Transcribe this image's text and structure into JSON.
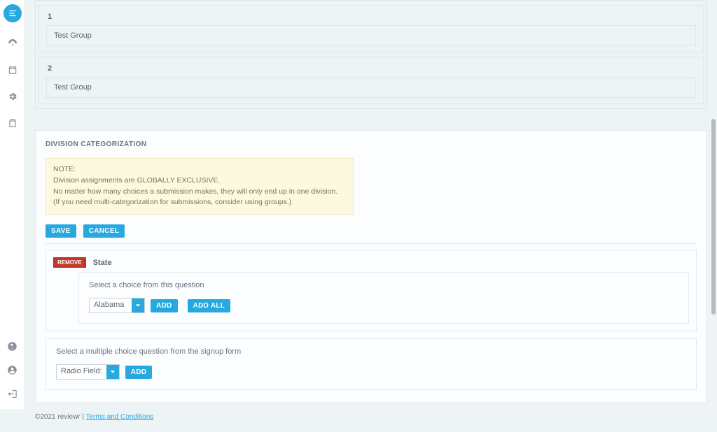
{
  "groups": [
    {
      "index": "1",
      "value": "Test Group"
    },
    {
      "index": "2",
      "value": "Test Group"
    }
  ],
  "division": {
    "title": "DIVISION CATEGORIZATION",
    "note_label": "NOTE:",
    "note_line1": "Division assignments are GLOBALLY EXCLUSIVE.",
    "note_line2": "No matter how many choices a submission makes, they will only end up in one division.",
    "note_line3": "(If you need multi-categorization for submissions, consider using groups.)",
    "save": "SAVE",
    "cancel": "CANCEL",
    "rule": {
      "remove": "REMOVE",
      "title": "State",
      "choice_label": "Select a choice from this question",
      "select_value": "Alabama",
      "add": "ADD",
      "add_all": "ADD ALL"
    },
    "question_prompt": "Select a multiple choice question from the signup form",
    "question_select": "Radio Field:",
    "question_add": "ADD"
  },
  "footer": {
    "copyright": "©2021 reviewr | ",
    "terms": "Terms and Conditions"
  }
}
